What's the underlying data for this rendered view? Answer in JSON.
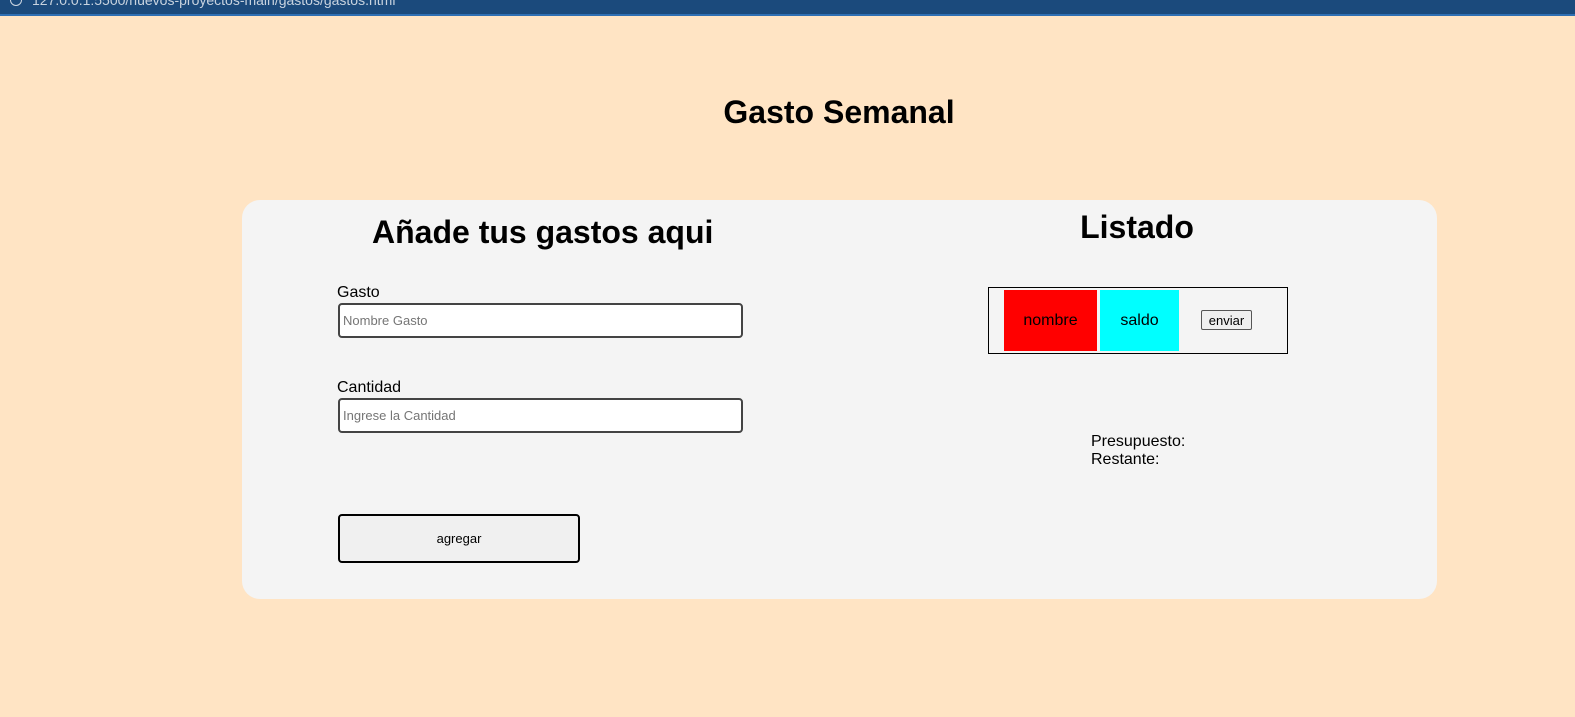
{
  "browser": {
    "url": "127.0.0.1:5500/nuevos-proyectos-main/gastos/gastos.html"
  },
  "page": {
    "title": "Gasto Semanal"
  },
  "form": {
    "heading": "Añade tus gastos aqui",
    "gasto_label": "Gasto",
    "gasto_placeholder": "Nombre Gasto",
    "gasto_value": "",
    "cantidad_label": "Cantidad",
    "cantidad_placeholder": "Ingrese la Cantidad",
    "cantidad_value": "",
    "add_button_label": "agregar"
  },
  "listado": {
    "heading": "Listado",
    "row": {
      "nombre": "nombre",
      "saldo": "saldo",
      "button_label": "enviar"
    },
    "presupuesto_label": "Presupuesto:",
    "restante_label": "Restante:"
  },
  "colors": {
    "page_background": "#ffe4c4",
    "panel_background": "#f4f4f4",
    "nombre_cell": "#ff0000",
    "saldo_cell": "#00ffff"
  }
}
